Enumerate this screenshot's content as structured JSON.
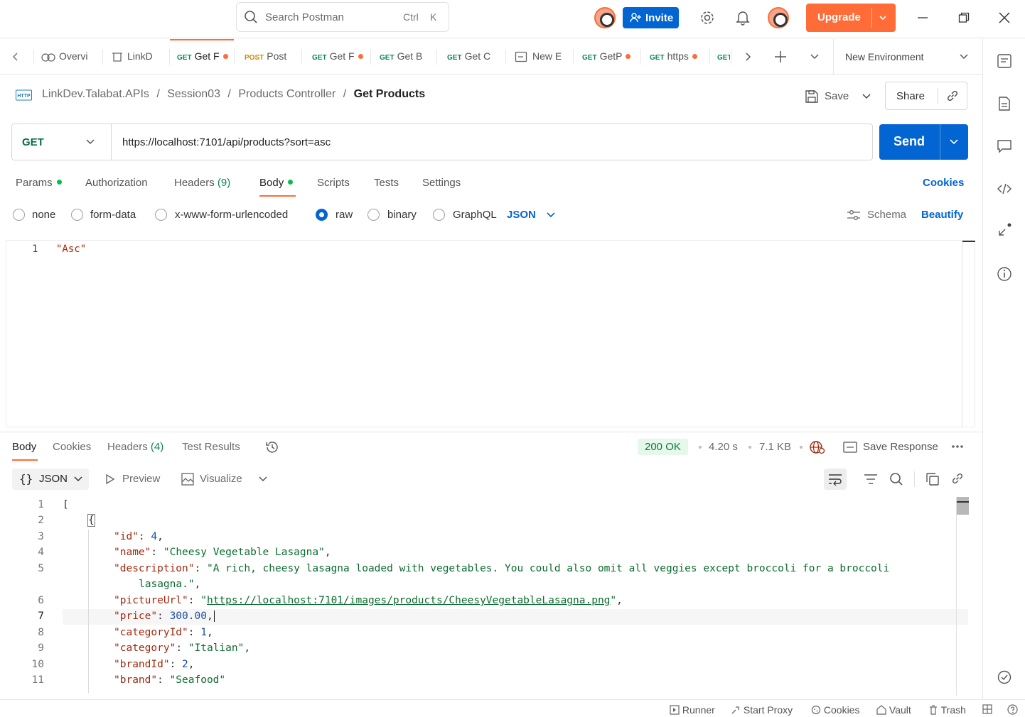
{
  "titlebar": {
    "search_placeholder": "Search Postman",
    "shortcut_ctrl": "Ctrl",
    "shortcut_key": "K",
    "invite_label": "Invite",
    "upgrade_label": "Upgrade"
  },
  "tabs": [
    {
      "method": "",
      "label": "Overvi"
    },
    {
      "method": "",
      "label": "LinkD"
    },
    {
      "method": "GET",
      "label": "Get F"
    },
    {
      "method": "POST",
      "label": "Post"
    },
    {
      "method": "GET",
      "label": "Get F"
    },
    {
      "method": "GET",
      "label": "Get B"
    },
    {
      "method": "GET",
      "label": "Get C"
    },
    {
      "method": "",
      "label": "New E"
    },
    {
      "method": "GET",
      "label": "GetP"
    },
    {
      "method": "GET",
      "label": "https"
    },
    {
      "method": "GET",
      "label": ""
    }
  ],
  "environment": "New Environment",
  "breadcrumb": {
    "http_badge": "HTTP",
    "parts": [
      "LinkDev.Talabat.APIs",
      "Session03",
      "Products Controller"
    ],
    "current": "Get Products",
    "separator": "/"
  },
  "actions": {
    "save": "Save",
    "share": "Share"
  },
  "request": {
    "method": "GET",
    "url": "https://localhost:7101/api/products?sort=asc",
    "send": "Send"
  },
  "request_tabs": [
    "Params",
    "Authorization",
    "Headers",
    "Body",
    "Scripts",
    "Tests",
    "Settings"
  ],
  "headers_count": "(9)",
  "cookies_link": "Cookies",
  "body_types": [
    "none",
    "form-data",
    "x-www-form-urlencoded",
    "raw",
    "binary",
    "GraphQL"
  ],
  "body_format": "JSON",
  "schema_label": "Schema",
  "beautify_label": "Beautify",
  "request_body": {
    "line": "1",
    "text": "\"Asc\""
  },
  "response": {
    "tabs": [
      "Body",
      "Cookies",
      "Headers",
      "Test Results"
    ],
    "headers_count": "(4)",
    "status": "200 OK",
    "time": "4.20 s",
    "size": "7.1 KB",
    "save_response": "Save Response",
    "view_mode": "JSON",
    "preview": "Preview",
    "visualize": "Visualize",
    "line_numbers": [
      "1",
      "2",
      "3",
      "4",
      "5",
      "6",
      "7",
      "8",
      "9",
      "10",
      "11"
    ],
    "lines": {
      "l1": "[",
      "l2": "{",
      "id_key": "\"id\"",
      "id_val": "4",
      "name_key": "\"name\"",
      "name_val": "\"Cheesy Vegetable Lasagna\"",
      "desc_key": "\"description\"",
      "desc_val_1": "\"A rich, cheesy lasagna loaded with vegetables. You could also omit all veggies except broccoli for a broccoli",
      "desc_val_2": "lasagna.\"",
      "pic_key": "\"pictureUrl\"",
      "pic_val": "https://localhost:7101/images/products/CheesyVegetableLasagna.png",
      "price_key": "\"price\"",
      "price_val": "300.00",
      "catid_key": "\"categoryId\"",
      "catid_val": "1",
      "cat_key": "\"category\"",
      "cat_val": "\"Italian\"",
      "brandid_key": "\"brandId\"",
      "brandid_val": "2",
      "brand_key": "\"brand\"",
      "brand_val": "\"Seafood\""
    }
  },
  "statusbar": [
    "Runner",
    "Start Proxy",
    "Cookies",
    "Vault",
    "Trash"
  ],
  "colors": {
    "accent_orange": "#ff6c37",
    "primary_blue": "#0265d2",
    "status_green": "#0cbb52"
  }
}
